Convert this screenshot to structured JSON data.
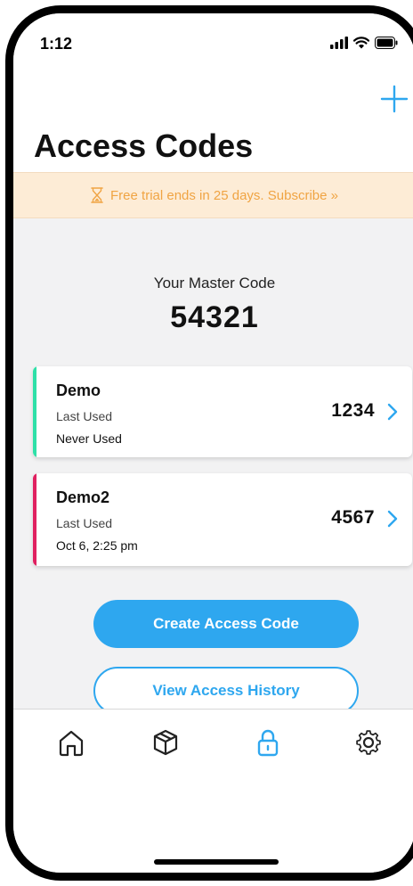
{
  "status": {
    "time": "1:12"
  },
  "header": {
    "title": "Access Codes"
  },
  "banner": {
    "text": "Free trial ends in 25 days. Subscribe »",
    "icon": "hourglass-icon",
    "color": "#f0a443"
  },
  "master": {
    "label": "Your Master Code",
    "code": "54321"
  },
  "codes": [
    {
      "name": "Demo",
      "last_used_label": "Last Used",
      "last_used": "Never Used",
      "code": "1234",
      "accent": "#2ee0a8"
    },
    {
      "name": "Demo2",
      "last_used_label": "Last Used",
      "last_used": "Oct 6, 2:25 pm",
      "code": "4567",
      "accent": "#e02060"
    }
  ],
  "actions": {
    "create": "Create Access Code",
    "history": "View Access History"
  },
  "tabs": [
    {
      "icon": "home-icon",
      "active": false
    },
    {
      "icon": "box-icon",
      "active": false
    },
    {
      "icon": "lock-icon",
      "active": true
    },
    {
      "icon": "gear-icon",
      "active": false
    }
  ],
  "colors": {
    "accent": "#2ea7ef"
  }
}
